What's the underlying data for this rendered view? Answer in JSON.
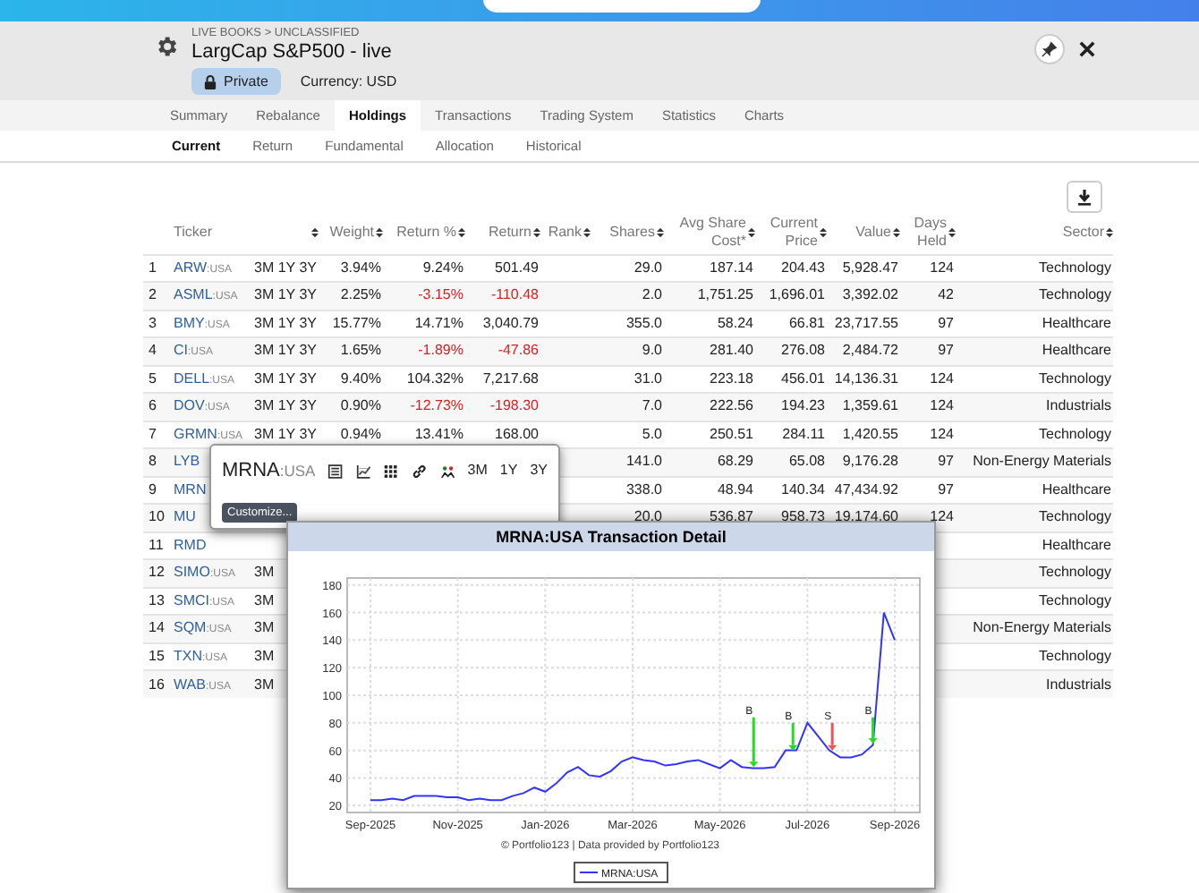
{
  "header": {
    "breadcrumb": "LIVE BOOKS > UNCLASSIFIED",
    "title": "LargCap S&P500 - live",
    "privacy": "Private",
    "currency": "Currency: USD"
  },
  "tabs": [
    {
      "label": "Summary",
      "selected": false
    },
    {
      "label": "Rebalance",
      "selected": false
    },
    {
      "label": "Holdings",
      "selected": true
    },
    {
      "label": "Transactions",
      "selected": false
    },
    {
      "label": "Trading System",
      "selected": false
    },
    {
      "label": "Statistics",
      "selected": false
    },
    {
      "label": "Charts",
      "selected": false
    }
  ],
  "subtabs": [
    {
      "label": "Current",
      "selected": true
    },
    {
      "label": "Return",
      "selected": false
    },
    {
      "label": "Fundamental",
      "selected": false
    },
    {
      "label": "Allocation",
      "selected": false
    },
    {
      "label": "Historical",
      "selected": false
    }
  ],
  "table": {
    "columns": [
      {
        "label": "Ticker"
      },
      {},
      {
        "label": "Weight"
      },
      {
        "label": "Return %"
      },
      {
        "label": "Return"
      },
      {
        "label": "Rank"
      },
      {
        "label": "Shares"
      },
      {
        "label": "Avg Share Cost*"
      },
      {
        "label": "Current Price"
      },
      {
        "label": "Value"
      },
      {
        "label": "Days Held"
      },
      {
        "label": "Sector"
      }
    ],
    "rows": [
      {
        "num": "1",
        "ticker": "ARW",
        "exchange": ":USA",
        "periods": "3M 1Y 3Y",
        "weight": "3.94%",
        "return_pct": "9.24%",
        "return": "501.49",
        "loss": false,
        "shares": "29.0",
        "avg_cost": "187.14",
        "price": "204.43",
        "value": "5,928.47",
        "days": "124",
        "sector": "Technology"
      },
      {
        "num": "2",
        "ticker": "ASML",
        "exchange": ":USA",
        "periods": "3M 1Y 3Y",
        "weight": "2.25%",
        "return_pct": "-3.15%",
        "return": "-110.48",
        "loss": true,
        "shares": "2.0",
        "avg_cost": "1,751.25",
        "price": "1,696.01",
        "value": "3,392.02",
        "days": "42",
        "sector": "Technology"
      },
      {
        "num": "3",
        "ticker": "BMY",
        "exchange": ":USA",
        "periods": "3M 1Y 3Y",
        "weight": "15.77%",
        "return_pct": "14.71%",
        "return": "3,040.79",
        "loss": false,
        "shares": "355.0",
        "avg_cost": "58.24",
        "price": "66.81",
        "value": "23,717.55",
        "days": "97",
        "sector": "Healthcare"
      },
      {
        "num": "4",
        "ticker": "CI",
        "exchange": ":USA",
        "periods": "3M 1Y 3Y",
        "weight": "1.65%",
        "return_pct": "-1.89%",
        "return": "-47.86",
        "loss": true,
        "shares": "9.0",
        "avg_cost": "281.40",
        "price": "276.08",
        "value": "2,484.72",
        "days": "97",
        "sector": "Healthcare"
      },
      {
        "num": "5",
        "ticker": "DELL",
        "exchange": ":USA",
        "periods": "3M 1Y 3Y",
        "weight": "9.40%",
        "return_pct": "104.32%",
        "return": "7,217.68",
        "loss": false,
        "shares": "31.0",
        "avg_cost": "223.18",
        "price": "456.01",
        "value": "14,136.31",
        "days": "124",
        "sector": "Technology"
      },
      {
        "num": "6",
        "ticker": "DOV",
        "exchange": ":USA",
        "periods": "3M 1Y 3Y",
        "weight": "0.90%",
        "return_pct": "-12.73%",
        "return": "-198.30",
        "loss": true,
        "shares": "7.0",
        "avg_cost": "222.56",
        "price": "194.23",
        "value": "1,359.61",
        "days": "124",
        "sector": "Industrials"
      },
      {
        "num": "7",
        "ticker": "GRMN",
        "exchange": ":USA",
        "periods": "3M 1Y 3Y",
        "weight": "0.94%",
        "return_pct": "13.41%",
        "return": "168.00",
        "loss": false,
        "shares": "5.0",
        "avg_cost": "250.51",
        "price": "284.11",
        "value": "1,420.55",
        "days": "124",
        "sector": "Technology"
      },
      {
        "num": "8",
        "ticker": "LYB",
        "shares": "141.0",
        "avg_cost": "68.29",
        "price": "65.08",
        "value": "9,176.28",
        "days": "97",
        "sector": "Non-Energy Materials"
      },
      {
        "num": "9",
        "ticker": "MRN",
        "shares": "338.0",
        "avg_cost": "48.94",
        "price": "140.34",
        "value": "47,434.92",
        "days": "97",
        "sector": "Healthcare"
      },
      {
        "num": "10",
        "ticker": "MU",
        "shares": "20.0",
        "avg_cost": "536.87",
        "price": "958.73",
        "value": "19,174.60",
        "days": "124",
        "sector": "Technology"
      },
      {
        "num": "11",
        "ticker": "RMD",
        "sector": "Healthcare"
      },
      {
        "num": "12",
        "ticker": "SIMO",
        "exchange": ":USA",
        "periods": "3M",
        "sector": "Technology"
      },
      {
        "num": "13",
        "ticker": "SMCI",
        "exchange": ":USA",
        "periods": "3M",
        "sector": "Technology"
      },
      {
        "num": "14",
        "ticker": "SQM",
        "exchange": ":USA",
        "periods": "3M",
        "sector": "Non-Energy Materials"
      },
      {
        "num": "15",
        "ticker": "TXN",
        "exchange": ":USA",
        "periods": "3M",
        "sector": "Technology"
      },
      {
        "num": "16",
        "ticker": "WAB",
        "exchange": ":USA",
        "periods": "3M",
        "sector": "Industrials"
      }
    ]
  },
  "popup": {
    "symbol": "MRNA",
    "exchange": ":USA",
    "periods": [
      "3M",
      "1Y",
      "3Y"
    ],
    "button": "Customize..."
  },
  "chart_window": {
    "footer": "© Portfolio123 | Data provided by Portfolio123",
    "markers": [
      {
        "text": "B",
        "kind": "buy"
      },
      {
        "text": "B",
        "kind": "buy"
      },
      {
        "text": "S",
        "kind": "sell"
      },
      {
        "text": "B",
        "kind": "buy"
      }
    ],
    "chart_data": {
      "type": "line",
      "grid": true,
      "title": "MRNA:USA Transaction Detail",
      "categories": [
        "Sep-2025",
        null,
        null,
        null,
        null,
        null,
        null,
        null,
        "Nov-2025",
        null,
        null,
        null,
        null,
        null,
        null,
        null,
        "Jan-2026",
        null,
        null,
        null,
        null,
        null,
        null,
        null,
        "Mar-2026",
        null,
        null,
        null,
        null,
        null,
        null,
        null,
        "May-2026",
        null,
        null,
        null,
        null,
        null,
        null,
        null,
        "Jul-2026",
        null,
        null,
        null,
        null,
        null,
        null,
        null,
        "Sep-2026"
      ],
      "series": [
        {
          "name": "MRNA:USA",
          "color": "#3333ff",
          "values": [
            24,
            24,
            25,
            24,
            27,
            27,
            27,
            26,
            26,
            24,
            25,
            24,
            24,
            27,
            29,
            33,
            30,
            36,
            44,
            48,
            42,
            41,
            45,
            52,
            55,
            53,
            52,
            49,
            50,
            52,
            53,
            50,
            47,
            53,
            48,
            47,
            47,
            48,
            60,
            60,
            80,
            70,
            60,
            55,
            55,
            57,
            64,
            160,
            140
          ]
        }
      ],
      "ylim": [
        15,
        185
      ],
      "yticks": [
        20,
        40,
        60,
        80,
        100,
        120,
        140,
        160,
        180
      ]
    }
  }
}
